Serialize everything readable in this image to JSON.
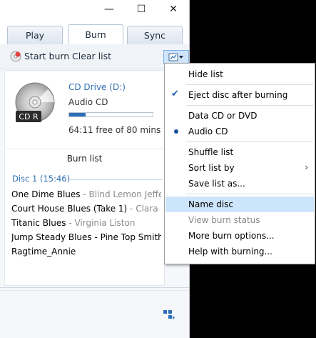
{
  "window": {
    "controls": {
      "minimize": "—",
      "maximize": "☐",
      "close": "✕"
    }
  },
  "tabs": [
    {
      "label": "Play"
    },
    {
      "label": "Burn"
    },
    {
      "label": "Sync"
    }
  ],
  "toolbar": {
    "start_burn": "Start burn",
    "clear_list": "Clear list"
  },
  "drive": {
    "name": "CD Drive (D:)",
    "type": "Audio CD",
    "free": "64:11 free of 80 mins",
    "used_fraction": 0.2,
    "icon_label": "CD R"
  },
  "burn_list": {
    "title": "Burn list",
    "disc_label": "Disc 1 (15:46)",
    "tracks": [
      {
        "title": "One Dime Blues",
        "artist": " - Blind Lemon Jeffe..."
      },
      {
        "title": "Court House Blues (Take 1)",
        "artist": " - Clara S..."
      },
      {
        "title": "Titanic Blues",
        "artist": " - Virginia Liston"
      },
      {
        "title": "Jump Steady Blues - Pine Top Smith",
        "artist": ""
      },
      {
        "title": "Ragtime_Annie",
        "artist": ""
      }
    ]
  },
  "menu": {
    "items": [
      {
        "label": "Hide list"
      },
      {
        "label": "Eject disc after burning",
        "checked": "✔"
      },
      {
        "label": "Data CD or DVD"
      },
      {
        "label": "Audio CD"
      },
      {
        "label": "Shuffle list"
      },
      {
        "label": "Sort list by",
        "submenu": "›"
      },
      {
        "label": "Save list as..."
      },
      {
        "label": "Name disc"
      },
      {
        "label": "View burn status"
      },
      {
        "label": "More burn options..."
      },
      {
        "label": "Help with burning..."
      }
    ]
  },
  "colors": {
    "accent": "#2c6fb7",
    "highlight": "#cde5fb",
    "drive_text": "#2f6fb1"
  }
}
